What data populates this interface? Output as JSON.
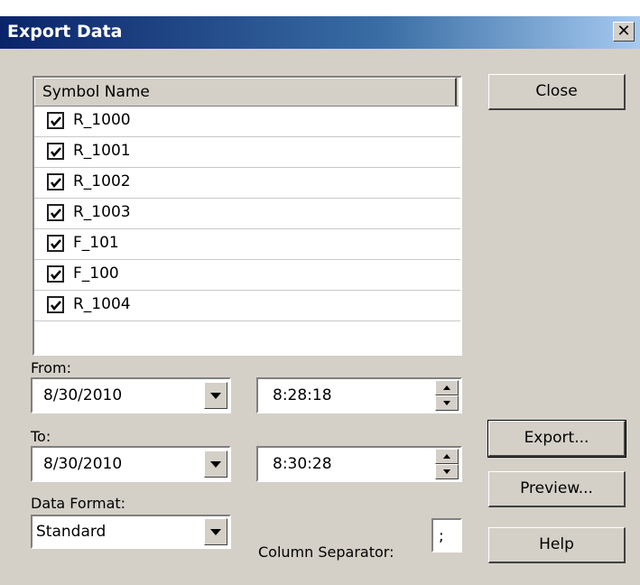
{
  "window": {
    "title": "Export Data",
    "close_glyph": "✕"
  },
  "symbol_list": {
    "header": "Symbol Name",
    "items": [
      {
        "label": "R_1000",
        "checked": true
      },
      {
        "label": "R_1001",
        "checked": true
      },
      {
        "label": "R_1002",
        "checked": true
      },
      {
        "label": "R_1003",
        "checked": true
      },
      {
        "label": "F_101",
        "checked": true
      },
      {
        "label": "F_100",
        "checked": true
      },
      {
        "label": "R_1004",
        "checked": true
      }
    ]
  },
  "from": {
    "label": "From:",
    "date": "8/30/2010",
    "time": "8:28:18"
  },
  "to": {
    "label": "To:",
    "date": "8/30/2010",
    "time": "8:30:28"
  },
  "data_format": {
    "label": "Data Format:",
    "value": "Standard"
  },
  "column_separator": {
    "label": "Column Separator:",
    "value": ";"
  },
  "buttons": {
    "close": "Close",
    "export": "Export...",
    "preview": "Preview...",
    "help": "Help"
  }
}
